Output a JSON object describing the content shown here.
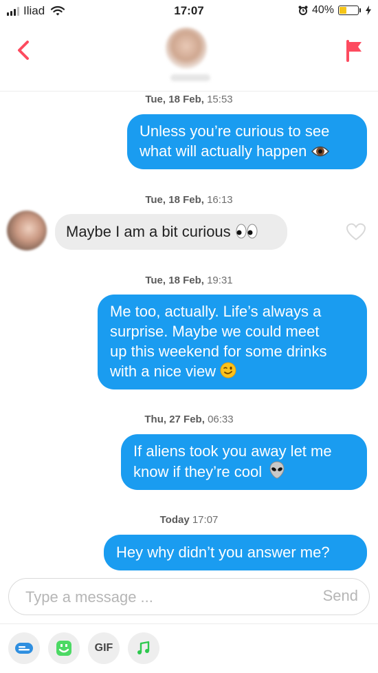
{
  "status_bar": {
    "carrier": "Iliad",
    "time": "17:07",
    "battery": "40%",
    "battery_level": 0.4
  },
  "header": {
    "back_icon": "chevron-left-icon",
    "report_icon": "flag-icon"
  },
  "messages": [
    {
      "stamp_day": "Tue, 18 Feb,",
      "stamp_time": "15:53",
      "direction": "out",
      "lines": [
        "Unless you’re curious to see",
        "what will actually happen"
      ],
      "emoji": "eye"
    },
    {
      "stamp_day": "Tue, 18 Feb,",
      "stamp_time": "16:13",
      "direction": "in",
      "lines": [
        "Maybe I am a bit curious"
      ],
      "emoji": "eyes"
    },
    {
      "stamp_day": "Tue, 18 Feb,",
      "stamp_time": "19:31",
      "direction": "out",
      "lines": [
        "Me too, actually. Life’s always a",
        "surprise. Maybe we could meet",
        "up this weekend for some drinks",
        "with a nice view"
      ],
      "emoji": "wink"
    },
    {
      "stamp_day": "Thu, 27 Feb,",
      "stamp_time": "06:33",
      "direction": "out",
      "lines": [
        "If aliens took you away let me",
        "know if they’re cool"
      ],
      "emoji": "alien"
    },
    {
      "stamp_day": "Today",
      "stamp_time": "17:07",
      "direction": "out",
      "lines": [
        "Hey why didn’t you answer me?"
      ],
      "emoji": ""
    }
  ],
  "composer": {
    "placeholder": "Type a message ...",
    "send_label": "Send"
  },
  "toolbar": {
    "gif_label": "GIF"
  },
  "colors": {
    "outgoing_bubble": "#1a9cf0",
    "incoming_bubble": "#ececec",
    "accent": "#fd4b5f",
    "emoji_tool": "#4cd964"
  }
}
